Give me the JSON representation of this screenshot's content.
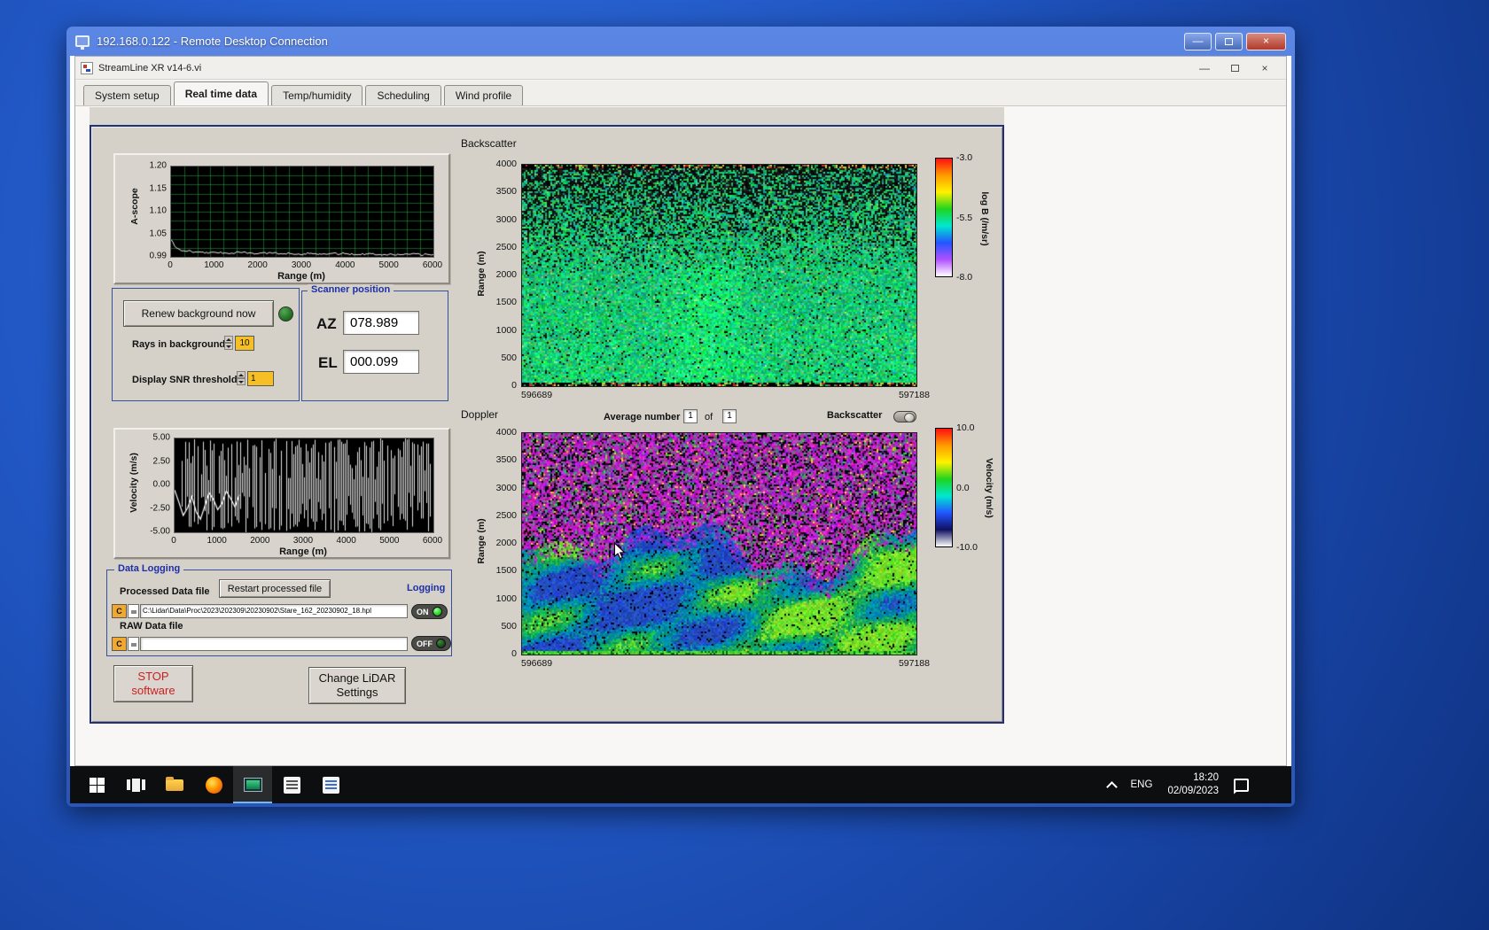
{
  "desktop": {
    "rdp_title": "192.168.0.122 - Remote Desktop Connection",
    "taskbar": {
      "lang": "ENG",
      "time": "18:20",
      "date": "02/09/2023"
    }
  },
  "app": {
    "title": "StreamLine XR v14-6.vi",
    "tabs": [
      {
        "label": "System setup"
      },
      {
        "label": "Real time data"
      },
      {
        "label": "Temp/humidity"
      },
      {
        "label": "Scheduling"
      },
      {
        "label": "Wind profile"
      }
    ]
  },
  "controls": {
    "renew_button": "Renew background now",
    "rays_label": "Rays in background",
    "rays_value": "10",
    "snr_label": "Display SNR threshold",
    "snr_value": "1"
  },
  "scanner": {
    "title": "Scanner position",
    "az_label": "AZ",
    "az_value": "078.989",
    "el_label": "EL",
    "el_value": "000.099"
  },
  "doppler_controls": {
    "avg_label": "Average number",
    "avg_value": "1",
    "of_label": "of",
    "of_value": "1",
    "toggle_label": "Backscatter"
  },
  "logging": {
    "title": "Data Logging",
    "processed_label": "Processed Data file",
    "restart_button": "Restart processed file",
    "logging_label": "Logging",
    "drive_label": "C",
    "processed_path": "C:\\Lidar\\Data\\Proc\\2023\\202309\\20230902\\Stare_162_20230902_18.hpl",
    "processed_state": "ON",
    "raw_label": "RAW Data file",
    "raw_path": "",
    "raw_state": "OFF"
  },
  "actions": {
    "stop_line1": "STOP",
    "stop_line2": "software",
    "change_line1": "Change LiDAR",
    "change_line2": "Settings"
  },
  "window_glyphs": {
    "minimize": "—",
    "close": "×"
  },
  "icons": {
    "start": "windows-logo",
    "task_view": "task-view",
    "file_explorer": "folder",
    "firefox": "orange-circle",
    "streamline": "green-screen",
    "tray_expand": "chevron-up",
    "action_center": "speech-square"
  },
  "chart_data": [
    {
      "id": "ascope",
      "type": "line",
      "ylabel": "A-scope",
      "xlabel": "Range (m)",
      "xlim": [
        0,
        6000
      ],
      "ylim": [
        0.99,
        1.2
      ],
      "ytick_labels": [
        "1.20",
        "1.15",
        "1.10",
        "1.05",
        "0.99"
      ],
      "xtick_labels": [
        "0",
        "1000",
        "2000",
        "3000",
        "4000",
        "5000",
        "6000"
      ],
      "grid": true,
      "x": [
        0,
        120,
        250,
        400,
        550,
        700,
        900,
        1100,
        1300,
        1500,
        1750,
        2000,
        2250,
        2500,
        2750,
        3000,
        3250,
        3500,
        3750,
        4000,
        4250,
        4500,
        4750,
        5000,
        5250,
        5500,
        5750,
        6000
      ],
      "y": [
        1.028,
        1.012,
        1.003,
        1.004,
        1.0,
        1.001,
        0.999,
        1.0,
        0.999,
        1.0,
        0.999,
        0.998,
        0.999,
        0.998,
        0.998,
        0.997,
        0.998,
        0.997,
        0.997,
        0.998,
        0.996,
        0.997,
        0.996,
        0.996,
        0.995,
        0.996,
        0.995,
        0.995
      ]
    },
    {
      "id": "velocity",
      "type": "line",
      "ylabel": "Velocity (m/s)",
      "xlabel": "Range (m)",
      "xlim": [
        0,
        6000
      ],
      "ylim": [
        -5,
        5
      ],
      "ytick_labels": [
        "5.00",
        "2.50",
        "0.00",
        "-2.50",
        "-5.00"
      ],
      "xtick_labels": [
        "0",
        "1000",
        "2000",
        "3000",
        "4000",
        "5000",
        "6000"
      ],
      "note": "coherent Doppler trace to ~1500 m, uncorrelated full-scale noise spikes beyond",
      "x": [
        0,
        100,
        200,
        300,
        400,
        500,
        600,
        700,
        800,
        900,
        1000,
        1100,
        1200,
        1300,
        1400,
        1500
      ],
      "y": [
        -0.5,
        -1.8,
        -3.2,
        -2.4,
        -1.2,
        -2.8,
        -3.6,
        -2.2,
        -0.8,
        -1.5,
        -2.6,
        -1.9,
        -0.6,
        -1.4,
        -2.3,
        -1.0
      ],
      "noise_range": [
        -5,
        5
      ]
    },
    {
      "id": "backscatter",
      "type": "heatmap",
      "title": "Backscatter",
      "ylabel": "Range (m)",
      "ylim": [
        0,
        4000
      ],
      "ytick_labels": [
        "4000",
        "3500",
        "3000",
        "2500",
        "2000",
        "1500",
        "1000",
        "500",
        "0"
      ],
      "x_start_label": "596689",
      "x_end_label": "597188",
      "colorbar": {
        "label": "log B (/m/sr)",
        "tick_labels": [
          "-3.0",
          "-5.5",
          "-8.0"
        ],
        "colors": [
          "#ff1010",
          "#ff9a00",
          "#fff200",
          "#1fd41f",
          "#00e8d0",
          "#2255ff",
          "#b050ff",
          "#ffffff"
        ]
      },
      "pattern": "uniform teal-green aerosol backscatter near -5.5 below ~2000 m, increasing black noise speckle with altitude"
    },
    {
      "id": "doppler",
      "type": "heatmap",
      "title": "Doppler",
      "ylabel": "Range (m)",
      "ylim": [
        0,
        4000
      ],
      "ytick_labels": [
        "4000",
        "3500",
        "3000",
        "2500",
        "2000",
        "1500",
        "1000",
        "500",
        "0"
      ],
      "x_start_label": "596689",
      "x_end_label": "597188",
      "colorbar": {
        "label": "Velocity (m/s)",
        "tick_labels": [
          "10.0",
          "0.0",
          "-10.0"
        ],
        "colors": [
          "#ff1010",
          "#ff9a00",
          "#fff200",
          "#1fd41f",
          "#00e8d0",
          "#2255ff",
          "#101060",
          "#ffffff"
        ]
      },
      "pattern": "coherent near-zero velocities (green/blue cloud) below ~1800 m, random magenta/black noise above"
    }
  ]
}
